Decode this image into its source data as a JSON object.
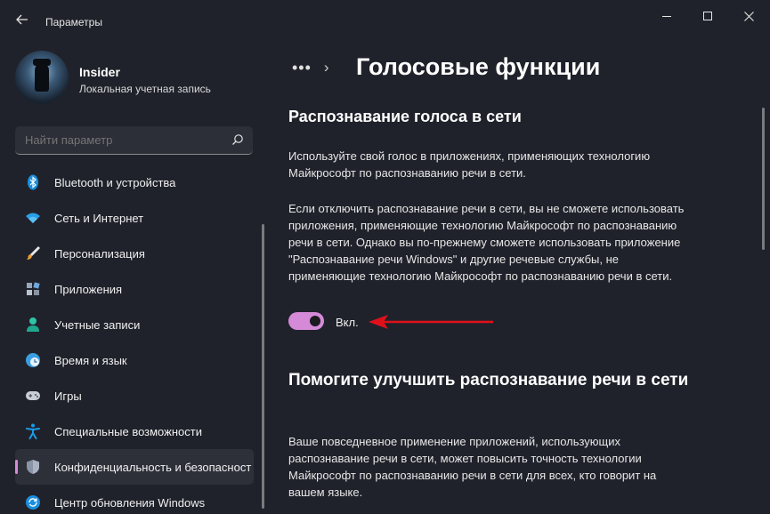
{
  "window": {
    "title": "Параметры"
  },
  "user": {
    "name": "Insider",
    "account_type": "Локальная учетная запись"
  },
  "search": {
    "placeholder": "Найти параметр"
  },
  "sidebar": {
    "items": [
      {
        "label": "Bluetooth и устройства",
        "icon": "bluetooth-icon",
        "active": false
      },
      {
        "label": "Сеть и Интернет",
        "icon": "wifi-icon",
        "active": false
      },
      {
        "label": "Персонализация",
        "icon": "brush-icon",
        "active": false
      },
      {
        "label": "Приложения",
        "icon": "apps-icon",
        "active": false
      },
      {
        "label": "Учетные записи",
        "icon": "person-icon",
        "active": false
      },
      {
        "label": "Время и язык",
        "icon": "clock-globe-icon",
        "active": false
      },
      {
        "label": "Игры",
        "icon": "gamepad-icon",
        "active": false
      },
      {
        "label": "Специальные возможности",
        "icon": "accessibility-icon",
        "active": false
      },
      {
        "label": "Конфиденциальность и безопасность",
        "icon": "shield-icon",
        "active": true
      },
      {
        "label": "Центр обновления Windows",
        "icon": "update-icon",
        "active": false
      }
    ]
  },
  "breadcrumb": {
    "dots": "•••",
    "separator": "›"
  },
  "page": {
    "title": "Голосовые функции",
    "section1_title": "Распознавание голоса в сети",
    "section1_p1": "Используйте свой голос в приложениях, применяющих технологию Майкрософт по распознаванию речи в сети.",
    "section1_p2": "Если отключить распознавание речи в сети, вы не сможете использовать приложения, применяющие технологию Майкрософт по распознаванию речи в сети. Однако вы по-прежнему сможете использовать приложение \"Распознавание речи Windows\" и другие речевые службы, не применяющие технологию Майкрософт по распознаванию речи в сети.",
    "toggle_label": "Вкл.",
    "toggle_on": true,
    "section2_title": "Помогите улучшить распознавание речи в сети",
    "section2_p1": "Ваше повседневное применение приложений, использующих распознавание речи в сети, может повысить точность технологии Майкрософт по распознаванию речи в сети для всех, кто говорит на вашем языке."
  },
  "colors": {
    "accent": "#d58ad8",
    "background": "#20222b",
    "annotation_arrow": "#e0101a"
  }
}
